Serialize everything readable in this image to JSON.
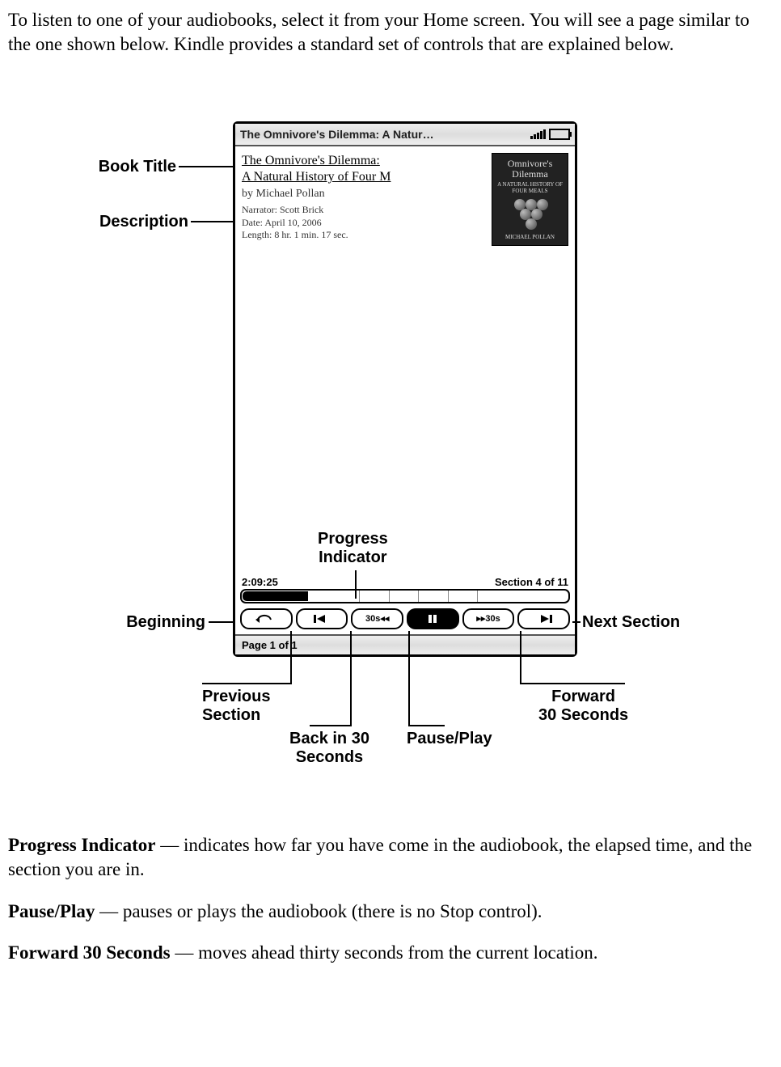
{
  "intro": "To listen to one of your audiobooks, select it from your Home screen. You will see a page similar to the one shown below. Kindle provides a standard set of controls that are explained below.",
  "labels": {
    "book_title": "Book Title",
    "description": "Description",
    "progress_indicator": "Progress\nIndicator",
    "beginning": "Beginning",
    "next_section": "Next Section",
    "previous_section": "Previous\nSection",
    "forward_30": "Forward\n30 Seconds",
    "back_30": "Back in 30\nSeconds",
    "pause_play": "Pause/Play"
  },
  "kindle": {
    "status_title": "The Omnivore's Dilemma: A Natur…",
    "book_title_line1": "The Omnivore's Dilemma:",
    "book_title_line2": "A Natural History of Four M",
    "author": "by Michael Pollan",
    "narrator": "Narrator: Scott Brick",
    "date": "Date: April 10, 2006",
    "length": "Length: 8 hr. 1 min. 17 sec.",
    "cover_title": "Omnivore's\nDilemma",
    "cover_subtitle": "A NATURAL HISTORY OF FOUR MEALS",
    "cover_author": "MICHAEL POLLAN",
    "elapsed": "2:09:25",
    "section": "Section 4 of 11",
    "page": "Page 1 of 1",
    "btn_back30": "30s◂◂",
    "btn_fwd30": "▸▸30s"
  },
  "definitions": {
    "progress_title": "Progress Indicator",
    "progress_body": " — indicates how far you have come in the audiobook, the elapsed time, and the section you are in.",
    "pause_title": "Pause/Play",
    "pause_body": " — pauses or plays the audiobook (there is no Stop control).",
    "fwd_title": "Forward 30 Seconds",
    "fwd_body": " — moves ahead thirty seconds from the current location."
  }
}
